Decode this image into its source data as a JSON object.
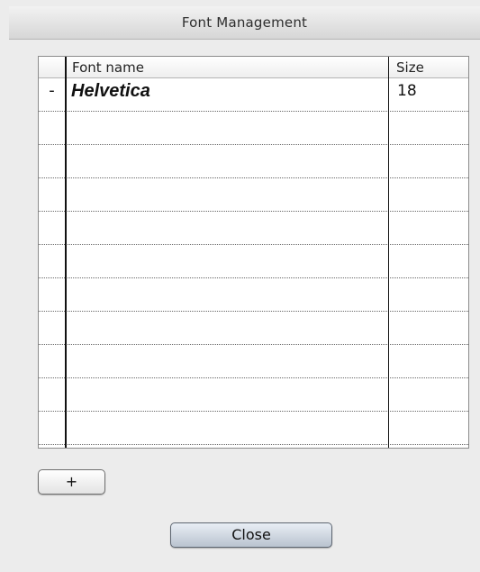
{
  "window": {
    "title": "Font Management"
  },
  "table": {
    "columns": {
      "name": "Font name",
      "size": "Size"
    },
    "rows": [
      {
        "remove_label": "-",
        "font_name": "Helvetica",
        "size": "18"
      },
      {
        "remove_label": "",
        "font_name": "",
        "size": ""
      },
      {
        "remove_label": "",
        "font_name": "",
        "size": ""
      },
      {
        "remove_label": "",
        "font_name": "",
        "size": ""
      },
      {
        "remove_label": "",
        "font_name": "",
        "size": ""
      },
      {
        "remove_label": "",
        "font_name": "",
        "size": ""
      },
      {
        "remove_label": "",
        "font_name": "",
        "size": ""
      },
      {
        "remove_label": "",
        "font_name": "",
        "size": ""
      },
      {
        "remove_label": "",
        "font_name": "",
        "size": ""
      },
      {
        "remove_label": "",
        "font_name": "",
        "size": ""
      },
      {
        "remove_label": "",
        "font_name": "",
        "size": ""
      }
    ]
  },
  "buttons": {
    "add_label": "+",
    "close_label": "Close"
  }
}
